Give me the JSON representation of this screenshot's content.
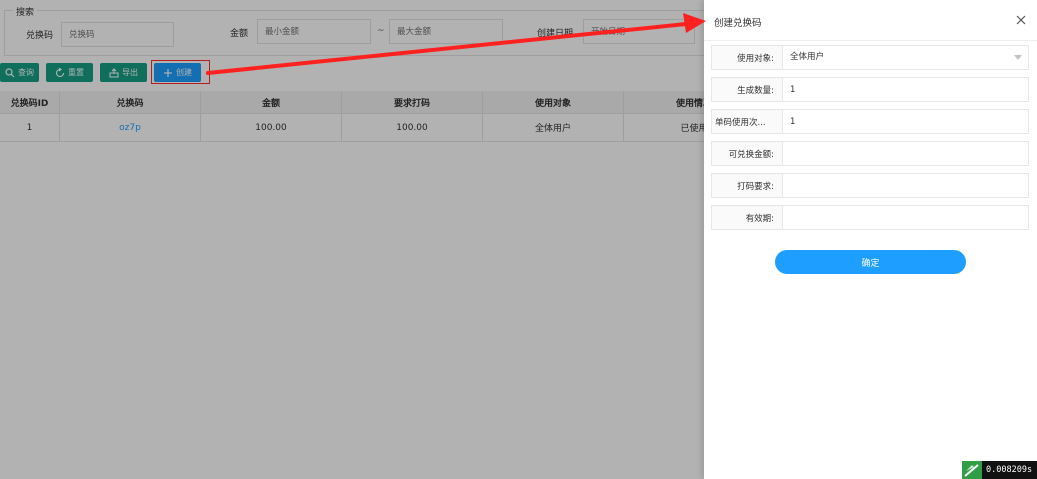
{
  "search": {
    "legend": "搜索",
    "code_label": "兑换码",
    "code_placeholder": "兑换码",
    "amount_label": "金额",
    "min_amount_placeholder": "最小金额",
    "range_sep": "~",
    "max_amount_placeholder": "最大金额",
    "date_label": "创建日期",
    "date_placeholder": "开始日期"
  },
  "toolbar": {
    "query_label": "查询",
    "reset_label": "重置",
    "export_label": "导出",
    "create_label": "创建"
  },
  "table": {
    "columns": [
      "兑换码ID",
      "兑换码",
      "金额",
      "要求打码",
      "使用对象",
      "使用情况"
    ],
    "rows": [
      [
        "1",
        "oz7p",
        "100.00",
        "100.00",
        "全体用户",
        "已使用"
      ]
    ]
  },
  "drawer": {
    "title": "创建兑换码",
    "fields": [
      {
        "label": "使用对象:",
        "value": "全体用户"
      },
      {
        "label": "生成数量:",
        "value": "1"
      },
      {
        "label": "单码使用次...",
        "value": "1"
      },
      {
        "label": "可兑换金额:",
        "value": ""
      },
      {
        "label": "打码要求:",
        "value": ""
      },
      {
        "label": "有效期:",
        "value": ""
      }
    ],
    "confirm_label": "确定"
  },
  "status": {
    "timer": "0.008209s"
  },
  "colors": {
    "teal": "#16a085",
    "blue": "#1e9fff",
    "annotation_red": "#ff2d2d"
  }
}
